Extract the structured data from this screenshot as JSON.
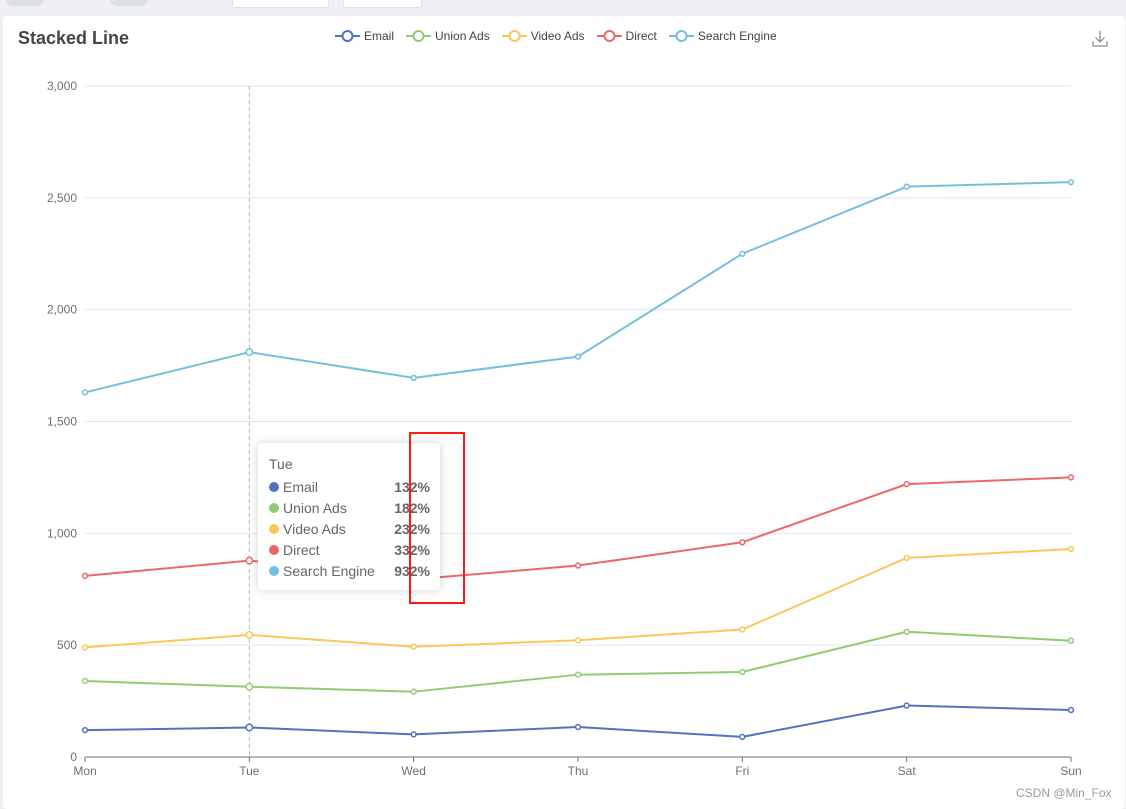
{
  "page": {
    "watermark": "CSDN @Min_Fox"
  },
  "toolbox": {
    "download_icon": "download-icon"
  },
  "tooltip": {
    "title": "Tue",
    "rows": [
      {
        "name": "Email",
        "value": "132%",
        "color": "#5470c6"
      },
      {
        "name": "Union Ads",
        "value": "182%",
        "color": "#91cc75"
      },
      {
        "name": "Video Ads",
        "value": "232%",
        "color": "#fac858"
      },
      {
        "name": "Direct",
        "value": "332%",
        "color": "#ee6666"
      },
      {
        "name": "Search Engine",
        "value": "932%",
        "color": "#73c0de"
      }
    ]
  },
  "chart_data": {
    "type": "line",
    "title": "Stacked Line",
    "stacked": true,
    "categories": [
      "Mon",
      "Tue",
      "Wed",
      "Thu",
      "Fri",
      "Sat",
      "Sun"
    ],
    "series": [
      {
        "name": "Email",
        "color": "#5470c6",
        "values": [
          120,
          132,
          101,
          134,
          90,
          230,
          210
        ]
      },
      {
        "name": "Union Ads",
        "color": "#91cc75",
        "values": [
          220,
          182,
          191,
          234,
          290,
          330,
          310
        ]
      },
      {
        "name": "Video Ads",
        "color": "#fac858",
        "values": [
          150,
          232,
          201,
          154,
          190,
          330,
          410
        ]
      },
      {
        "name": "Direct",
        "color": "#ee6666",
        "values": [
          320,
          332,
          301,
          334,
          390,
          330,
          320
        ]
      },
      {
        "name": "Search Engine",
        "color": "#73c0de",
        "values": [
          820,
          932,
          901,
          934,
          1290,
          1330,
          1320
        ]
      }
    ],
    "xlabel": "",
    "ylabel": "",
    "ylim": [
      0,
      3000
    ],
    "yticks": [
      0,
      500,
      1000,
      1500,
      2000,
      2500,
      3000
    ],
    "ytick_labels": [
      "0",
      "500",
      "1,000",
      "1,500",
      "2,000",
      "2,500",
      "3,000"
    ],
    "grid": true,
    "legend": "top-center",
    "axis_pointer_category": "Tue"
  }
}
